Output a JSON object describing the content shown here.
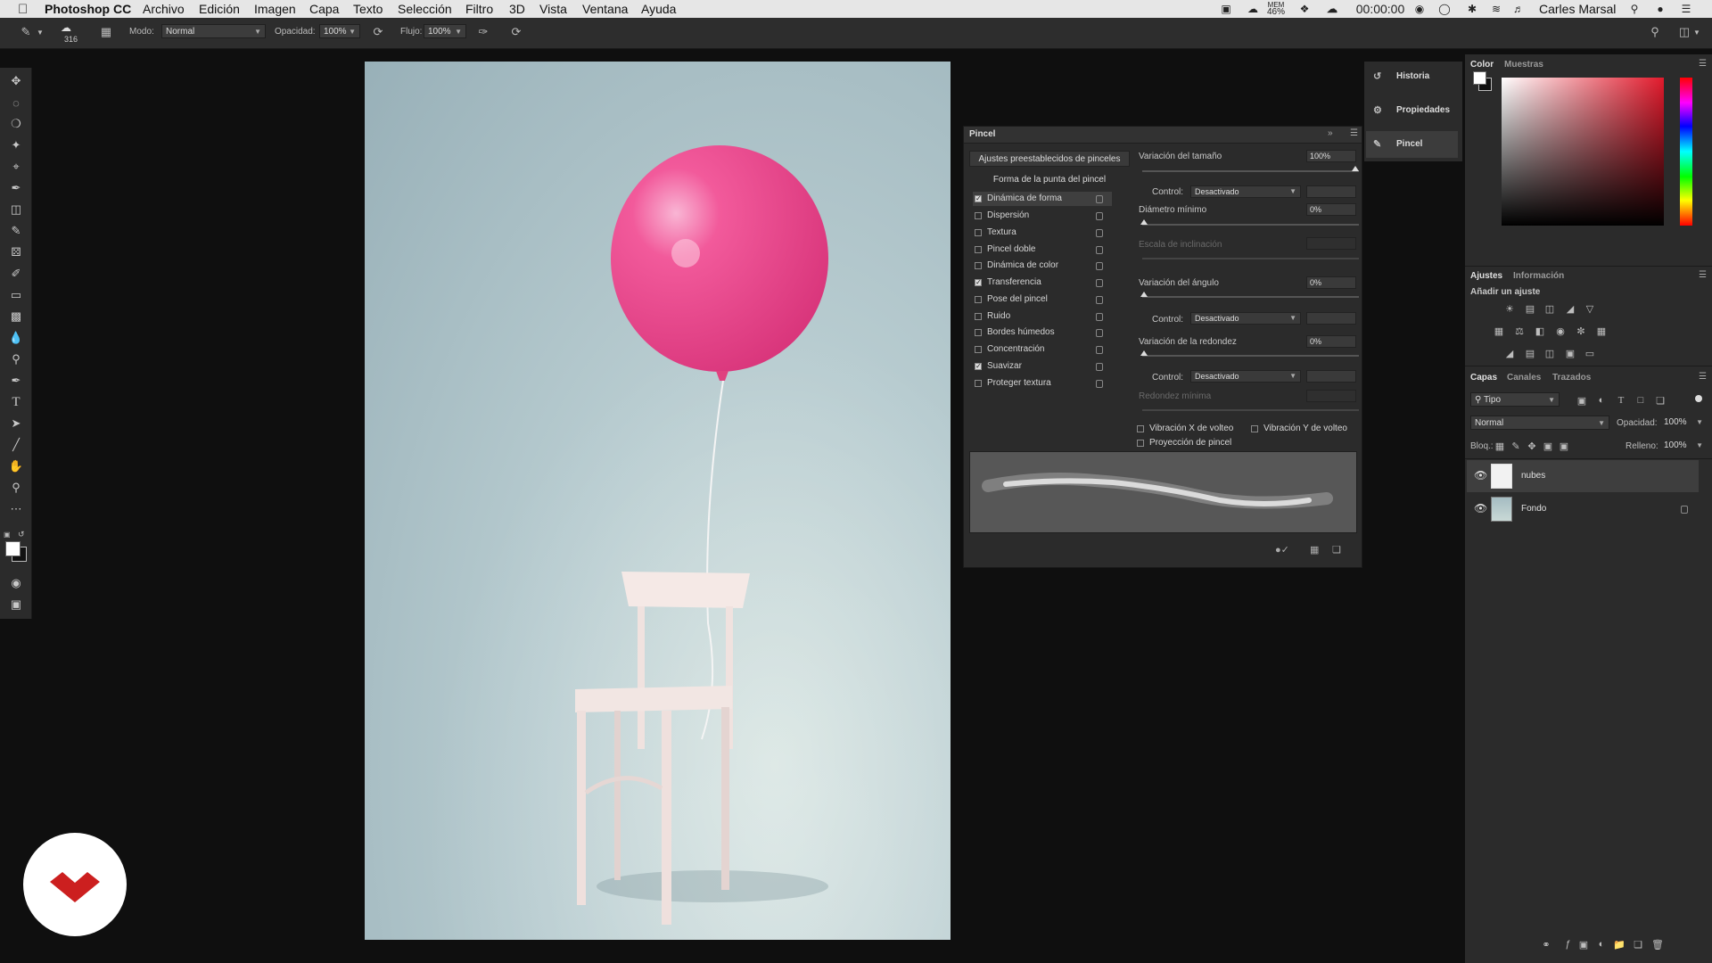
{
  "menubar": {
    "apple": "",
    "app_name": "Photoshop CC",
    "items": [
      "Archivo",
      "Edición",
      "Imagen",
      "Capa",
      "Texto",
      "Selección",
      "Filtro",
      "3D",
      "Vista",
      "Ventana",
      "Ayuda"
    ],
    "mem_label": "MEM",
    "mem_value": "46%",
    "clock": "00:00:00",
    "user": "Carles Marsal"
  },
  "options": {
    "brush_size": "316",
    "mode_label": "Modo:",
    "mode_value": "Normal",
    "opacity_label": "Opacidad:",
    "opacity_value": "100%",
    "flow_label": "Flujo:",
    "flow_value": "100%"
  },
  "brush_panel": {
    "title": "Pincel",
    "presets_button": "Ajustes preestablecidos de pinceles",
    "tip_shape": "Forma de la punta del pincel",
    "items": [
      {
        "label": "Dinámica de forma",
        "checked": true,
        "selected": true
      },
      {
        "label": "Dispersión",
        "checked": false
      },
      {
        "label": "Textura",
        "checked": false
      },
      {
        "label": "Pincel doble",
        "checked": false
      },
      {
        "label": "Dinámica de color",
        "checked": false
      },
      {
        "label": "Transferencia",
        "checked": true
      },
      {
        "label": "Pose del pincel",
        "checked": false
      },
      {
        "label": "Ruido",
        "checked": false
      },
      {
        "label": "Bordes húmedos",
        "checked": false
      },
      {
        "label": "Concentración",
        "checked": false
      },
      {
        "label": "Suavizar",
        "checked": true
      },
      {
        "label": "Proteger textura",
        "checked": false
      }
    ],
    "size_jitter_label": "Variación del tamaño",
    "size_jitter_value": "100%",
    "control_label": "Control:",
    "control_value": "Desactivado",
    "min_diameter_label": "Diámetro mínimo",
    "min_diameter_value": "0%",
    "tilt_scale_label": "Escala de inclinación",
    "angle_jitter_label": "Variación del ángulo",
    "angle_jitter_value": "0%",
    "roundness_jitter_label": "Variación de la redondez",
    "roundness_jitter_value": "0%",
    "min_roundness_label": "Redondez mínima",
    "flip_x_label": "Vibración X de volteo",
    "flip_y_label": "Vibración Y de volteo",
    "projection_label": "Proyección de pincel"
  },
  "collapsed_panels": [
    "Historia",
    "Propiedades",
    "Pincel"
  ],
  "color_panel": {
    "tabs": [
      "Color",
      "Muestras"
    ]
  },
  "adjustments_panel": {
    "tabs": [
      "Ajustes",
      "Información"
    ],
    "add_label": "Añadir un ajuste"
  },
  "layers_panel": {
    "tabs": [
      "Capas",
      "Canales",
      "Trazados"
    ],
    "filter_value": "Tipo",
    "blend_mode": "Normal",
    "opacity_label": "Opacidad:",
    "opacity_value": "100%",
    "lock_label": "Bloq.:",
    "fill_label": "Relleno:",
    "fill_value": "100%",
    "layers": [
      {
        "name": "nubes",
        "visible": true,
        "selected": true,
        "locked": false
      },
      {
        "name": "Fondo",
        "visible": true,
        "selected": false,
        "locked": true
      }
    ]
  },
  "colors": {
    "accent": "#cc1f1f",
    "balloon": "#ec4b8f",
    "canvas_bg": "#a9c0c6",
    "panel": "#2b2b2b"
  }
}
